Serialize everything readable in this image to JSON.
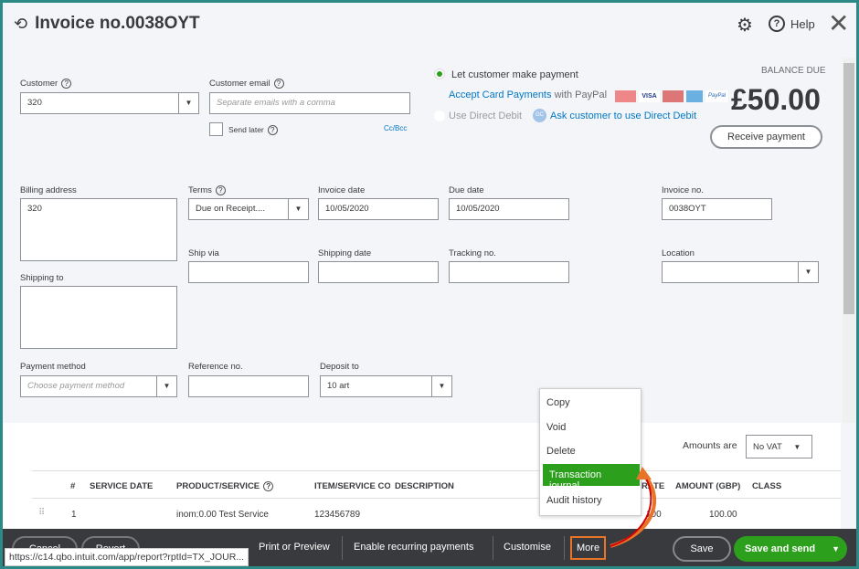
{
  "header": {
    "title": "Invoice no.0038OYT",
    "help_label": "Help"
  },
  "customer": {
    "label": "Customer",
    "value": "320"
  },
  "email": {
    "label": "Customer email",
    "placeholder": "Separate emails with a comma",
    "send_later": "Send later",
    "cc_bcc": "Cc/Bcc"
  },
  "payment": {
    "let_customer": "Let customer make payment",
    "accept_cards": "Accept Card Payments",
    "with_paypal": "with PayPal",
    "cards": [
      "MasterCard",
      "VISA",
      "Maestro",
      "AMEX",
      "PayPal"
    ],
    "direct_debit": "Use Direct Debit",
    "gc_badge": "GC",
    "ask_dd": "Ask customer to use Direct Debit"
  },
  "balance": {
    "label": "BALANCE DUE",
    "amount": "£50.00",
    "receive_button": "Receive payment"
  },
  "billing": {
    "label": "Billing address",
    "value": "320"
  },
  "terms": {
    "label": "Terms",
    "value": "Due on Receipt...."
  },
  "invoice_date": {
    "label": "Invoice date",
    "value": "10/05/2020"
  },
  "due_date": {
    "label": "Due date",
    "value": "10/05/2020"
  },
  "invoice_no": {
    "label": "Invoice no.",
    "value": "0038OYT"
  },
  "ship_via": {
    "label": "Ship via"
  },
  "shipping_date": {
    "label": "Shipping date"
  },
  "tracking": {
    "label": "Tracking no."
  },
  "location": {
    "label": "Location"
  },
  "shipping_to": {
    "label": "Shipping to"
  },
  "payment_method": {
    "label": "Payment method",
    "placeholder": "Choose payment method"
  },
  "reference": {
    "label": "Reference no."
  },
  "deposit": {
    "label": "Deposit to",
    "value": "10 art"
  },
  "amounts": {
    "label": "Amounts are",
    "value": "No VAT"
  },
  "table": {
    "columns": [
      "#",
      "SERVICE DATE",
      "PRODUCT/SERVICE",
      "ITEM/SERVICE CO",
      "DESCRIPTION",
      "RATE",
      "AMOUNT (GBP)",
      "CLASS"
    ],
    "rows": [
      {
        "num": "1",
        "product": "inom:0.00 Test Service",
        "code": "123456789",
        "rate": "100",
        "amount": "100.00"
      }
    ]
  },
  "more_menu": {
    "items": [
      "Copy",
      "Void",
      "Delete",
      "Transaction journal",
      "Audit history"
    ],
    "highlighted": "Transaction journal",
    "highlight_color": "#2ca01c"
  },
  "footer": {
    "cancel": "Cancel",
    "revert": "Revert",
    "print": "Print or Preview",
    "recurring": "Enable recurring payments",
    "customise": "Customise",
    "more": "More",
    "save": "Save",
    "save_send": "Save and send"
  },
  "status_url": "https://c14.qbo.intuit.com/app/report?rptId=TX_JOUR...",
  "colors": {
    "accent_green": "#2ca01c",
    "link": "#0077c5",
    "footer_bg": "#393a3d",
    "annotation": "#e8742a"
  }
}
